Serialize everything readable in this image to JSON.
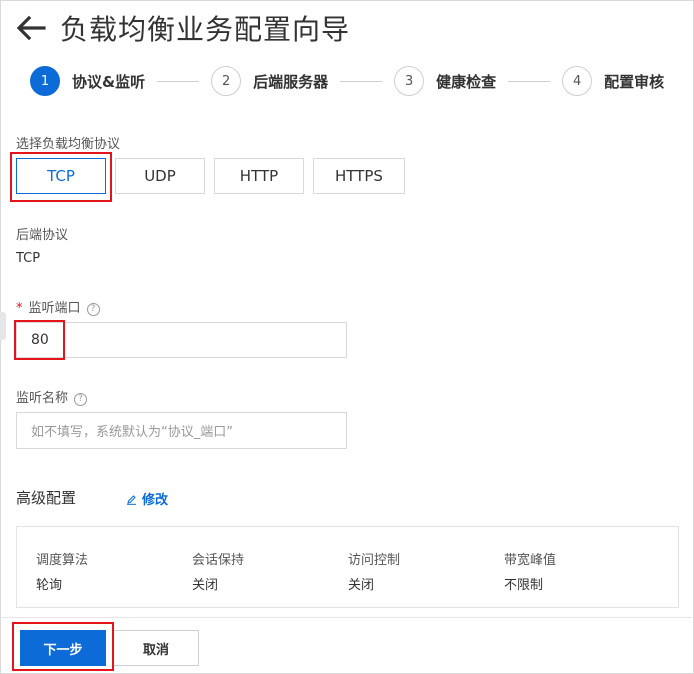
{
  "header": {
    "title": "负载均衡业务配置向导",
    "back_icon": "arrow-left-icon"
  },
  "steps": [
    {
      "num": "1",
      "label": "协议&监听",
      "active": true
    },
    {
      "num": "2",
      "label": "后端服务器",
      "active": false
    },
    {
      "num": "3",
      "label": "健康检查",
      "active": false
    },
    {
      "num": "4",
      "label": "配置审核",
      "active": false
    }
  ],
  "protocol": {
    "label": "选择负载均衡协议",
    "options": [
      "TCP",
      "UDP",
      "HTTP",
      "HTTPS"
    ],
    "selected": "TCP"
  },
  "backend": {
    "label": "后端协议",
    "value": "TCP"
  },
  "listen_port": {
    "required_mark": "*",
    "label": "监听端口",
    "value": "80"
  },
  "listen_name": {
    "label": "监听名称",
    "placeholder": "如不填写，系统默认为“协议_端口”"
  },
  "advanced": {
    "title": "高级配置",
    "edit_label": "修改",
    "items": [
      {
        "key": "调度算法",
        "value": "轮询"
      },
      {
        "key": "会话保持",
        "value": "关闭"
      },
      {
        "key": "访问控制",
        "value": "关闭"
      },
      {
        "key": "带宽峰值",
        "value": "不限制"
      }
    ]
  },
  "footer": {
    "next_label": "下一步",
    "cancel_label": "取消"
  },
  "colors": {
    "accent": "#0d6bd7",
    "highlight": "#e3151a"
  }
}
